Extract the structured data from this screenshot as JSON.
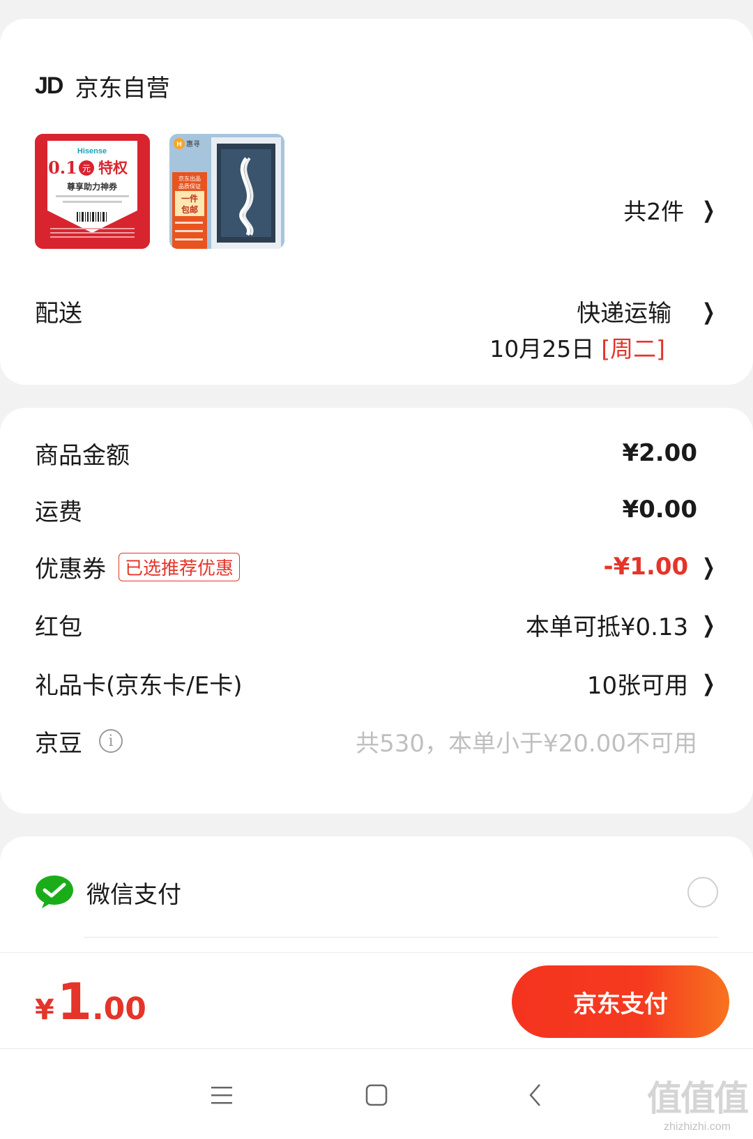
{
  "shop": {
    "logo": "JD",
    "name": "京东自营"
  },
  "products": {
    "count_label": "共2件",
    "thumb1": {
      "brand": "Hisense",
      "headline_amount": "0.1",
      "headline_unit": "元",
      "headline_suffix": "特权",
      "subtitle": "尊享助力神券"
    },
    "thumb2": {
      "brand": "惠寻",
      "tag_line1": "京东出品",
      "tag_line2": "品质保证",
      "tag_line3": "一件",
      "tag_line4": "包邮"
    }
  },
  "delivery": {
    "label": "配送",
    "method": "快递运输",
    "date": "10月25日",
    "weekday": "[周二]"
  },
  "summary": {
    "goods_label": "商品金额",
    "goods_value": "¥2.00",
    "shipping_label": "运费",
    "shipping_value": "¥0.00",
    "coupon_label": "优惠券",
    "coupon_tag": "已选推荐优惠",
    "coupon_value": "-¥1.00",
    "redpacket_label": "红包",
    "redpacket_value": "本单可抵¥0.13",
    "giftcard_label": "礼品卡(京东卡/E卡)",
    "giftcard_value": "10张可用",
    "jdbean_label": "京豆",
    "jdbean_value": "共530，本单小于¥20.00不可用"
  },
  "payment": {
    "wechat_label": "微信支付"
  },
  "paybar": {
    "currency": "¥",
    "total_int": "1",
    "total_dec": ".00",
    "button_label": "京东支付"
  },
  "watermark": {
    "big": "值值值",
    "small": "zhizhizhi.com"
  },
  "colors": {
    "accent": "#e5342a",
    "wechat": "#1aad19",
    "pay_button": "#f53a1f"
  },
  "icons": [
    "chevron-right-icon",
    "info-icon",
    "wechat-icon",
    "radio-unchecked",
    "menu-icon",
    "home-icon",
    "back-icon"
  ]
}
